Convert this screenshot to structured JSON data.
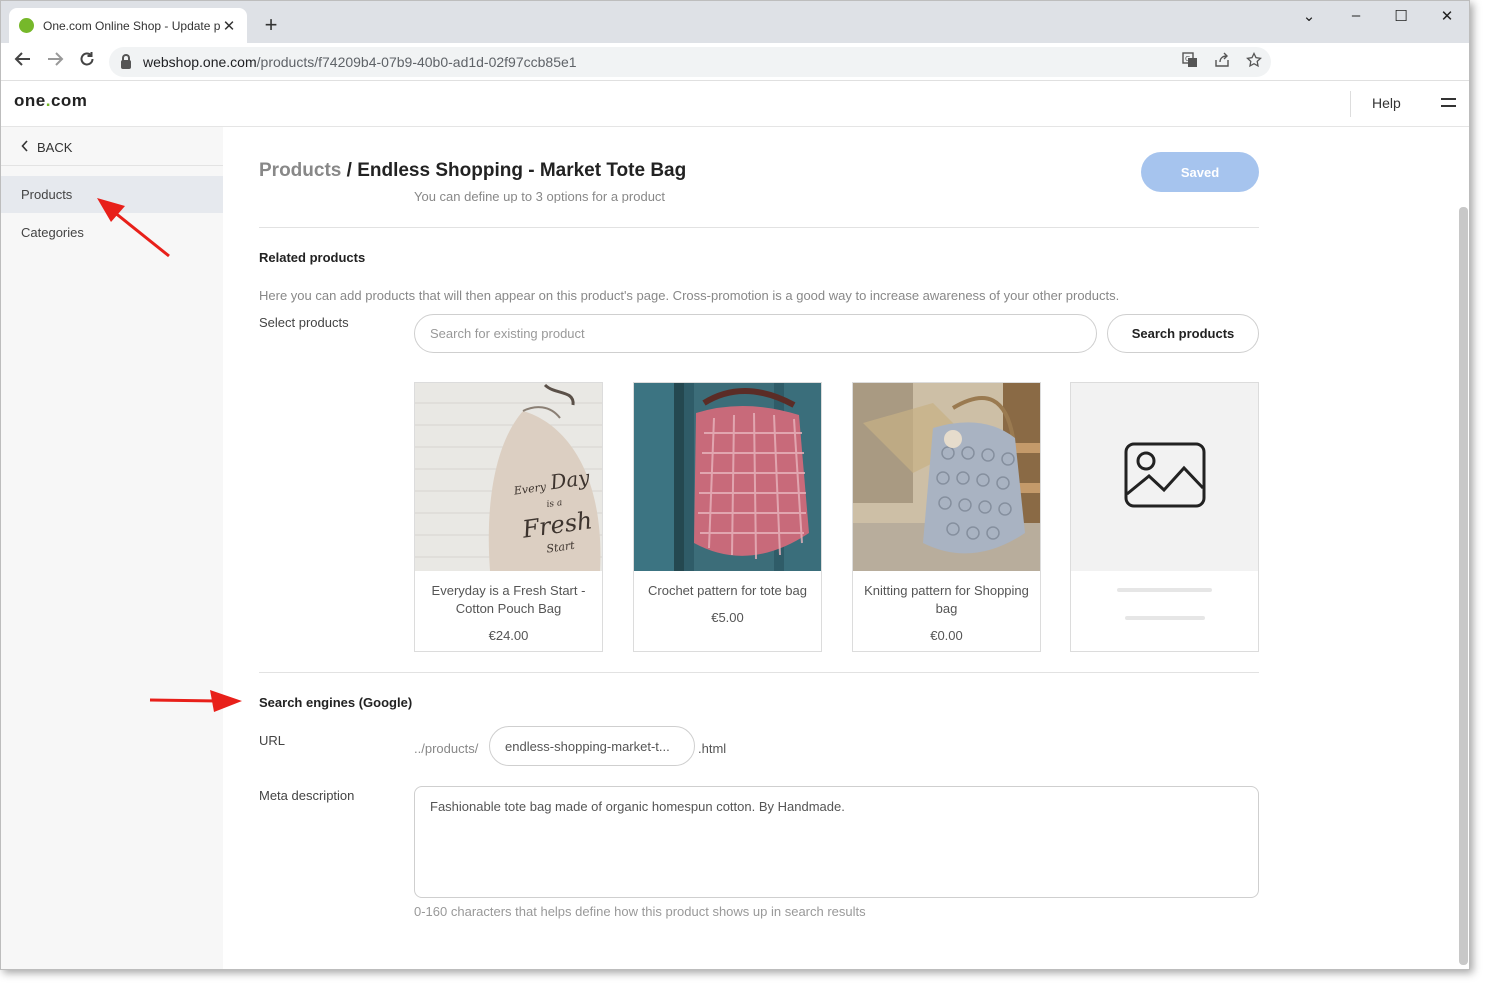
{
  "browser": {
    "tab_title": "One.com Online Shop - Update p",
    "new_tab": "+",
    "url_host": "webshop.one.com",
    "url_path": "/products/f74209b4-07b9-40b0-ad1d-02f97ccb85e1",
    "controls": {
      "dropdown": "⌄",
      "minimize": "–",
      "maximize": "☐",
      "close": "✕"
    }
  },
  "header": {
    "logo_main": "one",
    "logo_dot": ".",
    "logo_tail": "com",
    "help": "Help"
  },
  "sidebar": {
    "back": "BACK",
    "items": [
      {
        "label": "Products",
        "active": true
      },
      {
        "label": "Categories",
        "active": false
      }
    ]
  },
  "page": {
    "breadcrumb_root": "Products",
    "breadcrumb_sep": " / ",
    "breadcrumb_current": "Endless Shopping - Market Tote Bag",
    "save_button": "Saved",
    "options_hint": "You can define up to 3 options for a product"
  },
  "related": {
    "title": "Related products",
    "description": "Here you can add products that will then appear on this product's page. Cross-promotion is a good way to increase awareness of your other products.",
    "select_label": "Select products",
    "search_placeholder": "Search for existing product",
    "search_button": "Search products",
    "products": [
      {
        "name": "Everyday is a Fresh Start - Cotton Pouch Bag",
        "price": "€24.00",
        "image_text": [
          "Every",
          "Day",
          "is a",
          "Fresh",
          "Start"
        ]
      },
      {
        "name": "Crochet pattern for tote bag",
        "price": "€5.00"
      },
      {
        "name": "Knitting pattern for Shopping bag",
        "price": "€0.00"
      },
      {
        "name": "",
        "price": ""
      }
    ]
  },
  "seo": {
    "title": "Search engines (Google)",
    "url_label": "URL",
    "url_prefix": "../products/",
    "url_slug": "endless-shopping-market-t...",
    "url_suffix": ".html",
    "meta_label": "Meta description",
    "meta_value": "Fashionable tote bag made of organic homespun cotton. By Handmade.",
    "meta_help": "0-160 characters that helps define how this product shows up in search results"
  },
  "colors": {
    "brand_green": "#76b82a",
    "saved_button": "#a6c4ee",
    "annotation_arrow": "#e8201a"
  },
  "icons": [
    "back-arrow-icon",
    "forward-arrow-icon",
    "reload-icon",
    "lock-icon",
    "translate-icon",
    "share-icon",
    "star-icon",
    "menu-icon",
    "chevron-left-icon",
    "image-placeholder-icon"
  ]
}
